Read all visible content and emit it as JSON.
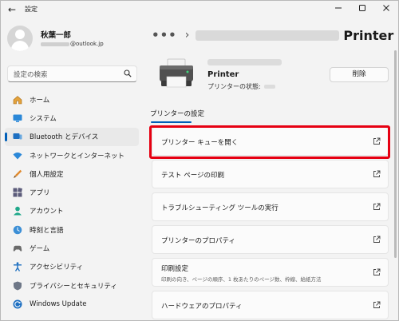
{
  "window": {
    "title": "設定",
    "back_glyph": "←"
  },
  "profile": {
    "name": "秋葉一郎",
    "email_suffix": "@outlook.jp"
  },
  "search": {
    "placeholder": "設定の検索"
  },
  "sidebar": {
    "items": [
      {
        "label": "ホーム",
        "icon": "home-icon",
        "selected": false
      },
      {
        "label": "システム",
        "icon": "system-icon",
        "selected": false
      },
      {
        "label": "Bluetooth とデバイス",
        "icon": "bluetooth-devices-icon",
        "selected": true
      },
      {
        "label": "ネットワークとインターネット",
        "icon": "network-icon",
        "selected": false
      },
      {
        "label": "個人用設定",
        "icon": "personalization-icon",
        "selected": false
      },
      {
        "label": "アプリ",
        "icon": "apps-icon",
        "selected": false
      },
      {
        "label": "アカウント",
        "icon": "account-icon",
        "selected": false
      },
      {
        "label": "時刻と言語",
        "icon": "time-language-icon",
        "selected": false
      },
      {
        "label": "ゲーム",
        "icon": "gaming-icon",
        "selected": false
      },
      {
        "label": "アクセシビリティ",
        "icon": "accessibility-icon",
        "selected": false
      },
      {
        "label": "プライバシーとセキュリティ",
        "icon": "privacy-shield-icon",
        "selected": false
      },
      {
        "label": "Windows Update",
        "icon": "windows-update-icon",
        "selected": false
      }
    ]
  },
  "breadcrumb": {
    "dots": "•••",
    "separator": "›",
    "title": "Printer"
  },
  "device": {
    "name": "Printer",
    "status_label": "プリンターの状態:"
  },
  "actions": {
    "delete_label": "削除"
  },
  "section": {
    "tab_label": "プリンターの設定"
  },
  "settings_items": [
    {
      "label": "プリンター キューを開く",
      "sub": "",
      "highlighted": true
    },
    {
      "label": "テスト ページの印刷",
      "sub": ""
    },
    {
      "label": "トラブルシューティング ツールの実行",
      "sub": ""
    },
    {
      "label": "プリンターのプロパティ",
      "sub": ""
    },
    {
      "label": "印刷設定",
      "sub": "印刷の向き、ページの順序、1 枚あたりのページ数、枠線、給紙方法"
    },
    {
      "label": "ハードウェアのプロパティ",
      "sub": ""
    }
  ],
  "colors": {
    "accent": "#005fb8",
    "highlight_box": "#e60012"
  }
}
